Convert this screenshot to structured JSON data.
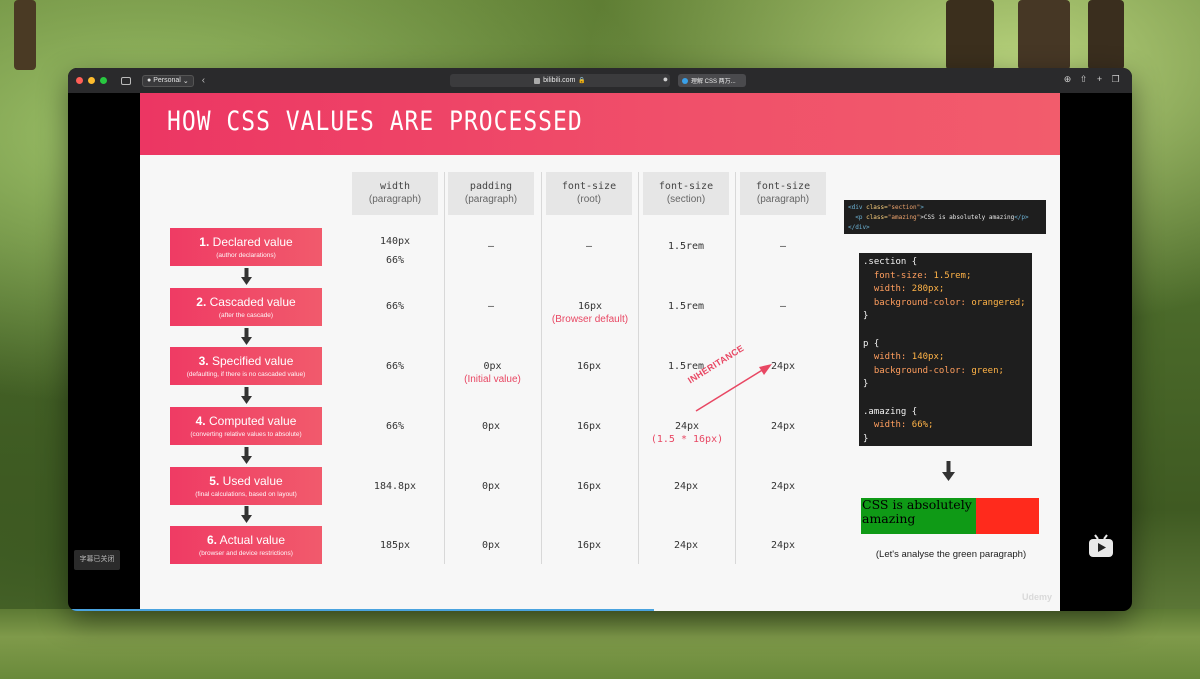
{
  "browser": {
    "profile_label": "Personal",
    "url": "bilibili.com",
    "tab_title": "理解 CSS 两万...",
    "traffic_colors": [
      "#ff5f57",
      "#febc2e",
      "#28c840"
    ]
  },
  "slide": {
    "title": "HOW CSS VALUES ARE PROCESSED",
    "columns": [
      {
        "title": "width",
        "sub": "(paragraph)"
      },
      {
        "title": "padding",
        "sub": "(paragraph)"
      },
      {
        "title": "font-size",
        "sub": "(root)"
      },
      {
        "title": "font-size",
        "sub": "(section)"
      },
      {
        "title": "font-size",
        "sub": "(paragraph)"
      }
    ],
    "steps": [
      {
        "num": "1.",
        "name": "Declared value",
        "sub": "(author declarations)"
      },
      {
        "num": "2.",
        "name": "Cascaded value",
        "sub": "(after the cascade)"
      },
      {
        "num": "3.",
        "name": "Specified value",
        "sub": "(defaulting, if there is no cascaded value)"
      },
      {
        "num": "4.",
        "name": "Computed value",
        "sub": "(converting relative values to absolute)"
      },
      {
        "num": "5.",
        "name": "Used value",
        "sub": "(final calculations, based on layout)"
      },
      {
        "num": "6.",
        "name": "Actual value",
        "sub": "(browser and device restrictions)"
      }
    ],
    "rows": [
      [
        {
          "v": "140px",
          "v2": "66%"
        },
        {
          "v": "—"
        },
        {
          "v": "—"
        },
        {
          "v": "1.5rem"
        },
        {
          "v": "—"
        }
      ],
      [
        {
          "v": "66%"
        },
        {
          "v": "—"
        },
        {
          "v": "16px",
          "note": "(Browser default)"
        },
        {
          "v": "1.5rem"
        },
        {
          "v": "—"
        }
      ],
      [
        {
          "v": "66%"
        },
        {
          "v": "0px",
          "note": "(Initial value)"
        },
        {
          "v": "16px"
        },
        {
          "v": "1.5rem"
        },
        {
          "v": "24px"
        }
      ],
      [
        {
          "v": "66%"
        },
        {
          "v": "0px"
        },
        {
          "v": "16px"
        },
        {
          "v": "24px",
          "note": "(1.5 * 16px)"
        },
        {
          "v": "24px"
        }
      ],
      [
        {
          "v": "184.8px"
        },
        {
          "v": "0px"
        },
        {
          "v": "16px"
        },
        {
          "v": "24px"
        },
        {
          "v": "24px"
        }
      ],
      [
        {
          "v": "185px"
        },
        {
          "v": "0px"
        },
        {
          "v": "16px"
        },
        {
          "v": "24px"
        },
        {
          "v": "24px"
        }
      ]
    ],
    "inheritance_label": "INHERITANCE",
    "html_code": {
      "line1_open": "<div",
      "line1_attr": " class=",
      "line1_val": "\"section\"",
      "line1_close": ">",
      "line2_open": "  <p",
      "line2_attr": " class=",
      "line2_val": "\"amazing\"",
      "line2_text": ">CSS is absolutely amazing",
      "line2_close": "</p>",
      "line3": "</div>"
    },
    "css_code": {
      "sel1": ".section {",
      "p1": "font-size:",
      "v1": "1.5rem;",
      "p2": "width:",
      "v2": "280px;",
      "p3": "background-color:",
      "v3": "orangered;",
      "sel2": "p {",
      "p4": "width:",
      "v4": "140px;",
      "p5": "background-color:",
      "v5": "green;",
      "sel3": ".amazing {",
      "p6": "width:",
      "v6": "66%;",
      "close": "}"
    },
    "demo_text": "CSS is absolutely amazing",
    "caption": "(Let's analyse the green paragraph)",
    "brand": "Udemy"
  },
  "player": {
    "subtitle_button": "字幕已关闭",
    "accent_color": "#f0506a"
  }
}
